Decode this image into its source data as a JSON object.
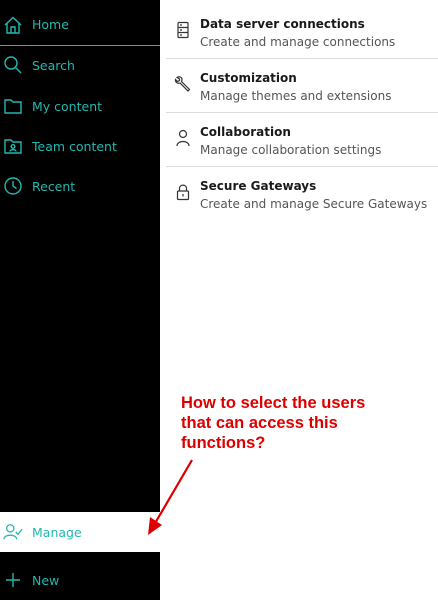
{
  "sidebar": {
    "items": [
      {
        "label": "Home",
        "icon": "home-icon"
      },
      {
        "label": "Search",
        "icon": "search-icon"
      },
      {
        "label": "My content",
        "icon": "folder-icon"
      },
      {
        "label": "Team content",
        "icon": "team-folder-icon"
      },
      {
        "label": "Recent",
        "icon": "clock-icon"
      }
    ],
    "manage": {
      "label": "Manage",
      "icon": "user-check-icon"
    },
    "new": {
      "label": "New",
      "icon": "plus-icon"
    }
  },
  "panel": {
    "items": [
      {
        "title": "Data server connections",
        "desc": "Create and manage connections",
        "icon": "server-icon"
      },
      {
        "title": "Customization",
        "desc": "Manage themes and extensions",
        "icon": "wrench-icon"
      },
      {
        "title": "Collaboration",
        "desc": "Manage collaboration settings",
        "icon": "user-icon"
      },
      {
        "title": "Secure Gateways",
        "desc": "Create and manage Secure Gateways",
        "icon": "lock-icon"
      }
    ]
  },
  "annotation": {
    "line1": "How to select the users",
    "line2": "that can access this",
    "line3": "functions?"
  },
  "colors": {
    "accent": "#22b8b0",
    "annotation": "#dd0000",
    "sidebar_bg": "#000000"
  }
}
